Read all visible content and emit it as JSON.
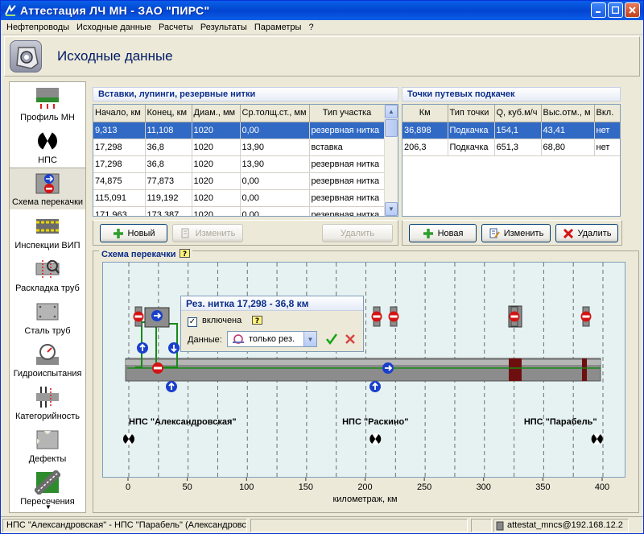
{
  "window": {
    "title": "Аттестация ЛЧ МН - ЗАО \"ПИРС\""
  },
  "menu": [
    "Нефтепроводы",
    "Исходные данные",
    "Расчеты",
    "Результаты",
    "Параметры",
    "?"
  ],
  "header": {
    "title": "Исходные данные"
  },
  "sidebar": {
    "items": [
      {
        "label": "Профиль МН",
        "icon": "profile-icon"
      },
      {
        "label": "НПС",
        "icon": "pump-station-icon"
      },
      {
        "label": "Схема перекачки",
        "icon": "pumping-scheme-icon",
        "active": true
      },
      {
        "label": "Инспекции ВИП",
        "icon": "inspection-icon"
      },
      {
        "label": "Раскладка труб",
        "icon": "pipe-layout-icon"
      },
      {
        "label": "Сталь труб",
        "icon": "steel-icon"
      },
      {
        "label": "Гидроиспытания",
        "icon": "pressure-gauge-icon"
      },
      {
        "label": "Категорийность",
        "icon": "category-icon"
      },
      {
        "label": "Дефекты",
        "icon": "defect-icon"
      },
      {
        "label": "Пересечения",
        "icon": "crossing-icon"
      }
    ]
  },
  "inserts": {
    "title": "Вставки, лупинги, резервные нитки",
    "columns": [
      "Начало, км",
      "Конец, км",
      "Диам., мм",
      "Ср.толщ.ст., мм",
      "Тип участка"
    ],
    "rows": [
      [
        "9,313",
        "11,108",
        "1020",
        "0,00",
        "резервная нитка"
      ],
      [
        "17,298",
        "36,8",
        "1020",
        "13,90",
        "вставка"
      ],
      [
        "17,298",
        "36,8",
        "1020",
        "13,90",
        "резервная нитка"
      ],
      [
        "74,875",
        "77,873",
        "1020",
        "0,00",
        "резервная нитка"
      ],
      [
        "115,091",
        "119,192",
        "1020",
        "0,00",
        "резервная нитка"
      ],
      [
        "171,963",
        "173,387",
        "1020",
        "0,00",
        "резервная нитка"
      ]
    ],
    "selected_row": 0,
    "buttons": {
      "new": "Новый",
      "edit": "Изменить",
      "delete": "Удалить"
    }
  },
  "boost_points": {
    "title": "Точки путевых подкачек",
    "columns": [
      "Км",
      "Тип точки",
      "Q, куб.м/ч",
      "Выс.отм., м",
      "Вкл."
    ],
    "rows": [
      [
        "36,898",
        "Подкачка",
        "154,1",
        "43,41",
        "нет"
      ],
      [
        "206,3",
        "Подкачка",
        "651,3",
        "68,80",
        "нет"
      ]
    ],
    "selected_row": 0,
    "buttons": {
      "new": "Новая",
      "edit": "Изменить",
      "delete": "Удалить"
    }
  },
  "scheme": {
    "title": "Схема перекачки",
    "axis": {
      "label": "километраж, км",
      "min": 0,
      "max": 400,
      "ticks": [
        "0",
        "50",
        "100",
        "150",
        "200",
        "250",
        "300",
        "350",
        "400"
      ]
    },
    "stations": [
      {
        "name": "НПС \"Александровская\"",
        "km": 0
      },
      {
        "name": "НПС \"Раскино\"",
        "km": 208
      },
      {
        "name": "НПС \"Парабель\"",
        "km": 395
      }
    ],
    "popup": {
      "title": "Рез. нитка 17,298 - 36,8 км",
      "enabled_label": "включена",
      "enabled": true,
      "data_label": "Данные:",
      "data_value": "только рез."
    }
  },
  "status": {
    "route": "НПС \"Александровская\" - НПС \"Парабель\" (Александровск",
    "connection": "attestat_mncs@192.168.12.2"
  }
}
